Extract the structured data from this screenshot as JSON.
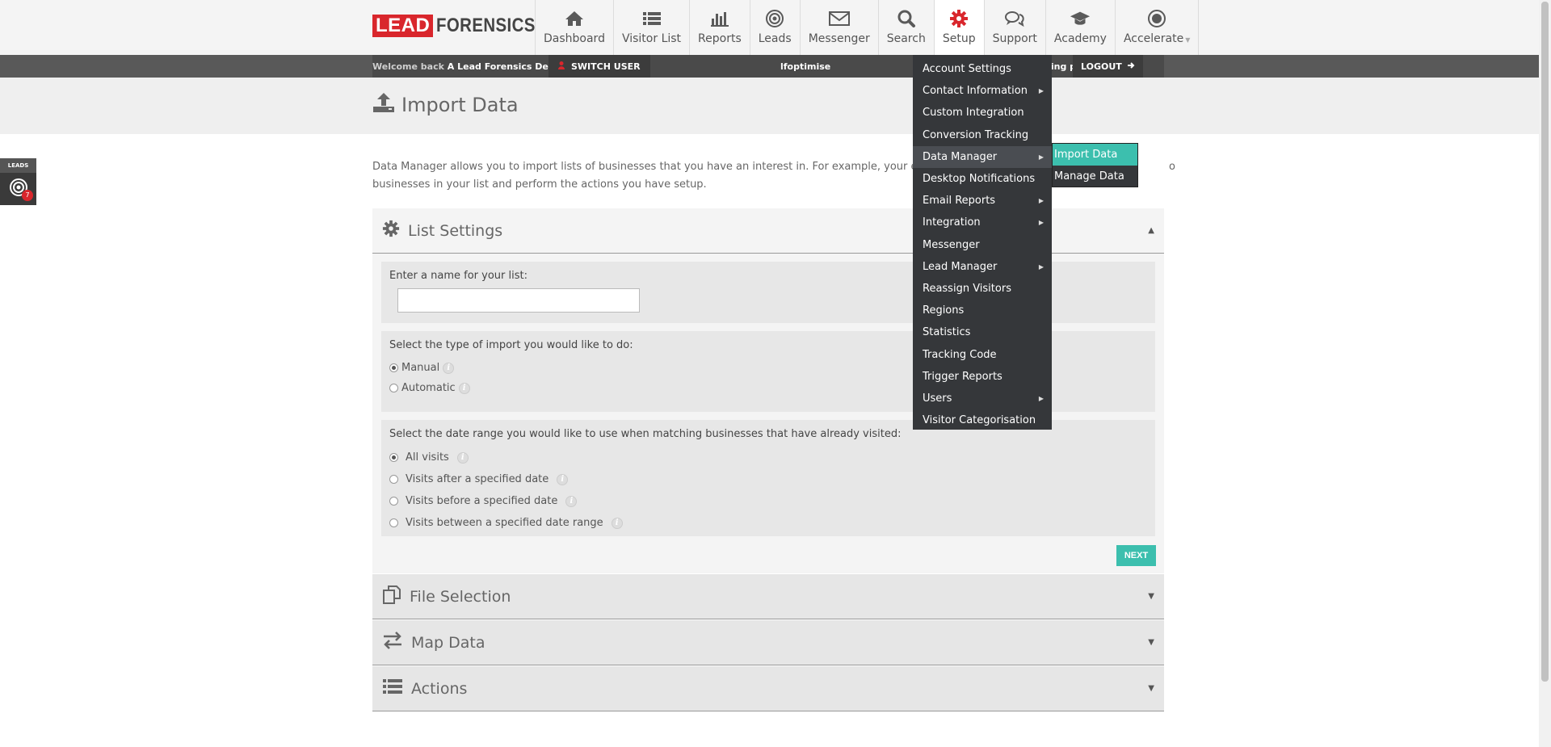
{
  "brand": {
    "logo_box": "LEAD",
    "logo_text": "FORENSICS"
  },
  "nav": [
    {
      "label": "Dashboard",
      "icon": "home-icon"
    },
    {
      "label": "Visitor List",
      "icon": "list-icon"
    },
    {
      "label": "Reports",
      "icon": "bar-chart-icon"
    },
    {
      "label": "Leads",
      "icon": "target-icon"
    },
    {
      "label": "Messenger",
      "icon": "envelope-icon"
    },
    {
      "label": "Search",
      "icon": "search-icon"
    },
    {
      "label": "Setup",
      "icon": "gear-icon"
    },
    {
      "label": "Support",
      "icon": "chat-icon"
    },
    {
      "label": "Academy",
      "icon": "graduation-cap-icon"
    },
    {
      "label": "Accelerate",
      "icon": "accelerate-icon"
    }
  ],
  "welcome": {
    "prefix": "Welcome back",
    "name": "A Lead Forensics Demo",
    "switch_user": "SWITCH USER",
    "account": "lfoptimise",
    "landing": "ding page",
    "logout": "LOGOUT"
  },
  "page": {
    "title": "Import Data"
  },
  "leads_tab": {
    "label": "LEADS",
    "count": "7"
  },
  "intro": {
    "line1": "Data Manager allows you to import lists of businesses that you have an interest in. For example, your exisiting cli",
    "line1_tail": "o",
    "line2": "businesses in your list and perform the actions you have setup."
  },
  "list_settings": {
    "title": "List Settings",
    "name_prompt": "Enter a name for your list:",
    "name_value": "",
    "import_prompt": "Select the type of import you would like to do:",
    "import_options": [
      "Manual",
      "Automatic"
    ],
    "import_selected": "Manual",
    "date_prompt": "Select the date range you would like to use when matching businesses that have already visited:",
    "date_options": [
      "All visits",
      "Visits after a specified date",
      "Visits before a specified date",
      "Visits between a specified date range"
    ],
    "date_selected": "All visits",
    "next": "NEXT"
  },
  "panels": {
    "file_selection": "File Selection",
    "map_data": "Map Data",
    "actions": "Actions"
  },
  "setup_menu": [
    {
      "label": "Account Settings",
      "sub": false
    },
    {
      "label": "Contact Information",
      "sub": true
    },
    {
      "label": "Custom Integration",
      "sub": false
    },
    {
      "label": "Conversion Tracking",
      "sub": false
    },
    {
      "label": "Data Manager",
      "sub": true
    },
    {
      "label": "Desktop Notifications",
      "sub": false
    },
    {
      "label": "Email Reports",
      "sub": true
    },
    {
      "label": "Integration",
      "sub": true
    },
    {
      "label": "Messenger",
      "sub": false
    },
    {
      "label": "Lead Manager",
      "sub": true
    },
    {
      "label": "Reassign Visitors",
      "sub": false
    },
    {
      "label": "Regions",
      "sub": false
    },
    {
      "label": "Statistics",
      "sub": false
    },
    {
      "label": "Tracking Code",
      "sub": false
    },
    {
      "label": "Trigger Reports",
      "sub": false
    },
    {
      "label": "Users",
      "sub": true
    },
    {
      "label": "Visitor Categorisation",
      "sub": false
    }
  ],
  "data_manager_submenu": [
    "Import Data",
    "Manage Data"
  ],
  "colors": {
    "brand_red": "#d9262c",
    "teal": "#3cbfae",
    "menu_bg": "#35373a"
  }
}
